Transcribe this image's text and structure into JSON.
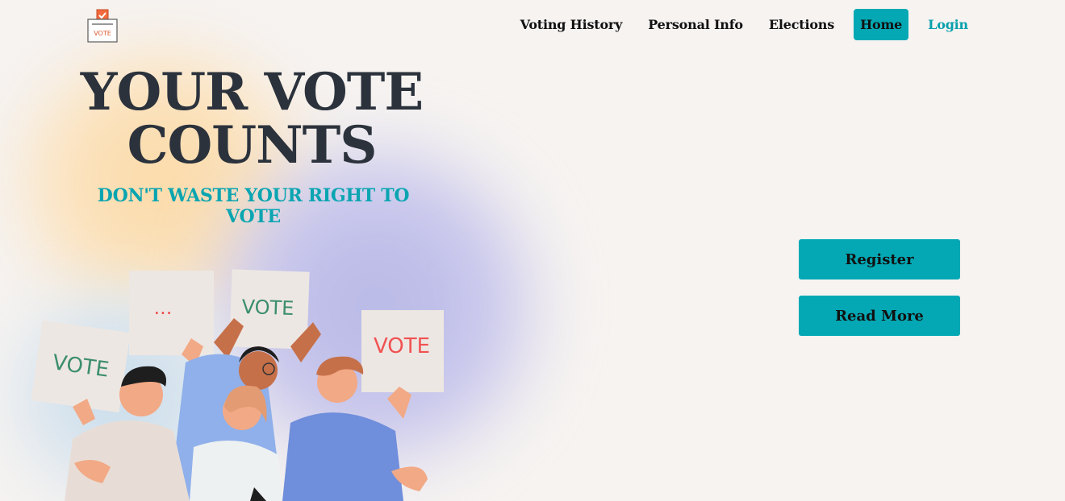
{
  "logo": {
    "icon": "ballot-box-icon",
    "text": "VOTE"
  },
  "nav": {
    "items": [
      {
        "label": "Voting History"
      },
      {
        "label": "Personal Info"
      },
      {
        "label": "Elections"
      },
      {
        "label": "Home"
      },
      {
        "label": "Login"
      }
    ]
  },
  "hero": {
    "title_line1": "YOUR VOTE",
    "title_line2": "COUNTS",
    "subtitle": "DON'T WASTE YOUR RIGHT TO VOTE"
  },
  "actions": {
    "register_label": "Register",
    "read_more_label": "Read More"
  },
  "illustration": {
    "signs": [
      "VOTE",
      "...",
      "VOTE",
      "VOTE"
    ]
  },
  "colors": {
    "accent": "#03a8b4",
    "subtitle": "#0aa5b1",
    "title": "#2b323c",
    "background": "#f6f3f1"
  }
}
